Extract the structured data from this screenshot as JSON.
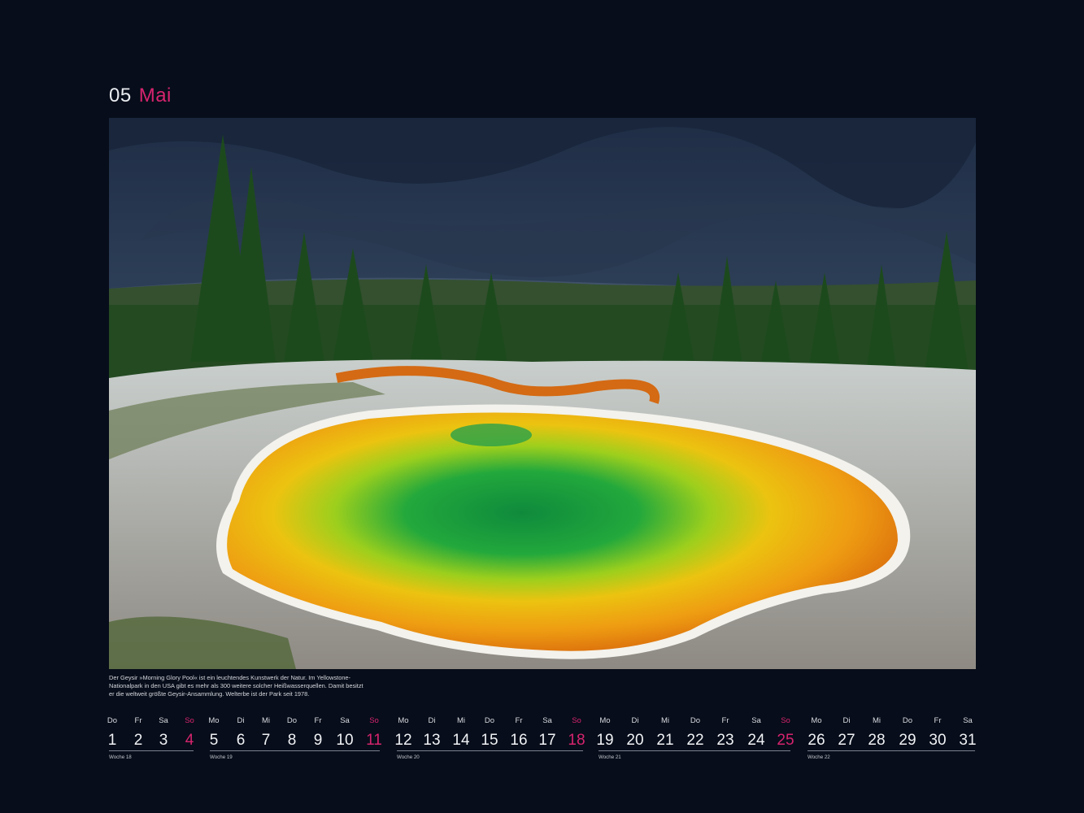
{
  "header": {
    "month_number": "05",
    "month_name": "Mai"
  },
  "photo": {
    "subject": "hot-spring-landscape"
  },
  "caption": "Der Geysir »Morning Glory Pool« ist ein leuchtendes Kunstwerk der Natur. Im Yellowstone-Nationalpark in den USA gibt es mehr als 300 weitere solcher Heißwasserquellen. Damit besitzt er die weltweit größte Geysir-Ansammlung. Welterbe ist der Park seit 1978.",
  "colors": {
    "accent": "#d6246f",
    "background": "#070d1a"
  },
  "weeks": [
    {
      "label": "Woche 18",
      "days": [
        {
          "dow": "Do",
          "num": "1",
          "sun": false
        },
        {
          "dow": "Fr",
          "num": "2",
          "sun": false
        },
        {
          "dow": "Sa",
          "num": "3",
          "sun": false
        },
        {
          "dow": "So",
          "num": "4",
          "sun": true
        }
      ]
    },
    {
      "label": "Woche 19",
      "days": [
        {
          "dow": "Mo",
          "num": "5",
          "sun": false
        },
        {
          "dow": "Di",
          "num": "6",
          "sun": false
        },
        {
          "dow": "Mi",
          "num": "7",
          "sun": false
        },
        {
          "dow": "Do",
          "num": "8",
          "sun": false
        },
        {
          "dow": "Fr",
          "num": "9",
          "sun": false
        },
        {
          "dow": "Sa",
          "num": "10",
          "sun": false
        },
        {
          "dow": "So",
          "num": "11",
          "sun": true
        }
      ]
    },
    {
      "label": "Woche 20",
      "days": [
        {
          "dow": "Mo",
          "num": "12",
          "sun": false
        },
        {
          "dow": "Di",
          "num": "13",
          "sun": false
        },
        {
          "dow": "Mi",
          "num": "14",
          "sun": false
        },
        {
          "dow": "Do",
          "num": "15",
          "sun": false
        },
        {
          "dow": "Fr",
          "num": "16",
          "sun": false
        },
        {
          "dow": "Sa",
          "num": "17",
          "sun": false
        },
        {
          "dow": "So",
          "num": "18",
          "sun": true
        }
      ]
    },
    {
      "label": "Woche 21",
      "days": [
        {
          "dow": "Mo",
          "num": "19",
          "sun": false
        },
        {
          "dow": "Di",
          "num": "20",
          "sun": false
        },
        {
          "dow": "Mi",
          "num": "21",
          "sun": false
        },
        {
          "dow": "Do",
          "num": "22",
          "sun": false
        },
        {
          "dow": "Fr",
          "num": "23",
          "sun": false
        },
        {
          "dow": "Sa",
          "num": "24",
          "sun": false
        },
        {
          "dow": "So",
          "num": "25",
          "sun": true
        }
      ]
    },
    {
      "label": "Woche 22",
      "days": [
        {
          "dow": "Mo",
          "num": "26",
          "sun": false
        },
        {
          "dow": "Di",
          "num": "27",
          "sun": false
        },
        {
          "dow": "Mi",
          "num": "28",
          "sun": false
        },
        {
          "dow": "Do",
          "num": "29",
          "sun": false
        },
        {
          "dow": "Fr",
          "num": "30",
          "sun": false
        },
        {
          "dow": "Sa",
          "num": "31",
          "sun": false
        }
      ]
    }
  ]
}
